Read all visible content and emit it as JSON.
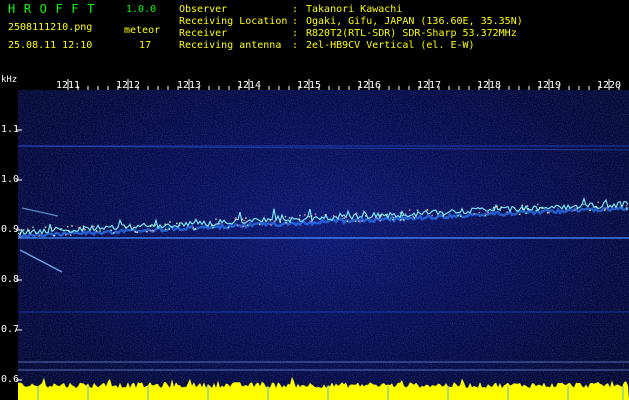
{
  "app": {
    "name": "HROFFT",
    "version": "1.0.0"
  },
  "capture": {
    "filename": "2508111210.png",
    "datetime": "25.08.11 12:10",
    "meteor_label": "meteor",
    "meteor_count": "17"
  },
  "info": {
    "rows": [
      {
        "label": "Observer",
        "value": "Takanori Kawachi"
      },
      {
        "label": "Receiving Location",
        "value": "Ogaki, Gifu, JAPAN (136.60E, 35.35N)"
      },
      {
        "label": "Receiver",
        "value": "R820T2(RTL-SDR) SDR-Sharp 53.372MHz"
      },
      {
        "label": "Receiving antenna",
        "value": "2el-HB9CV Vertical (el. E-W)"
      }
    ],
    "separator": ":"
  },
  "axes": {
    "y_unit": "kHz",
    "time_ticks": [
      "1211",
      "1212",
      "1213",
      "1214",
      "1215",
      "1216",
      "1217",
      "1218",
      "1219",
      "1220"
    ],
    "freq_ticks": [
      "1.1",
      "1.0",
      "0.9",
      "0.8",
      "0.7",
      "0.6"
    ],
    "freq_values": [
      1.1,
      1.0,
      0.9,
      0.8,
      0.7,
      0.6
    ]
  },
  "colors": {
    "text_green": "#00ff00",
    "text_yellow": "#ffff00",
    "text_white": "#ffffff",
    "background": "#000000",
    "spectrogram_bg": "#050c4e",
    "signal": "#7ff0ff",
    "signal_bright": "#ffffcc",
    "grid_blue": "#2b4bd8",
    "noise_bar": "#ffff00"
  }
}
